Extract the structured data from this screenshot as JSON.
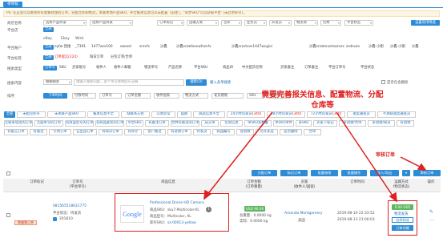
{
  "tab_label": "待审核",
  "notice": "PS: 在这里可以看到所有需要处理的订单，分配仓库和物流，关联本地产品SKU，补全报关信息可以去配置（前往），\"同步SKU\"可以获取平台（未启用库存）。",
  "filters": {
    "shop_name_label": "商店名称",
    "platform_label": "平台店",
    "platform_account_label": "平台账户",
    "platform_tags_label": "平台标签",
    "search_type_label": "搜索类型",
    "search_content_label": "搜索内容",
    "sort_label": "排序",
    "row1": [
      "选择产品目录",
      "选择产品目录",
      "订单标记",
      "运输方式",
      "仓库",
      "业务员",
      "开发员",
      "物流商",
      "包材",
      "平台状态"
    ],
    "advanced_search": "设置常用筛选",
    "platforms": [
      "eBay",
      "Ebay",
      "Wish"
    ],
    "platform_selected": "全部",
    "accounts": [
      "全部",
      "eyfw-团维",
      "_T391",
      "1477azv100",
      "ewasd",
      "srzvfx",
      "沙鑫",
      "沙鑫srzwfxzvwfxzvfx",
      "沙鑫srzvtxvs1447wcgioi",
      "沙鑫srzwtxvetxzzvzx",
      "zsdsvza",
      "沙鑫-小刚",
      "沙鑫-小刚",
      "沙鑫"
    ],
    "tags": [
      "已标记",
      "订单留言(224)",
      "缺货订单",
      "分包订单/合单"
    ],
    "search_types": [
      "订单号",
      "SKU",
      "买家账号",
      "收件人",
      "收件人邮箱",
      "物流单号",
      "产品名称",
      "平台SKU",
      "商品ID",
      "中文配货名称",
      "买家备注",
      "订单备注",
      "平台订单号",
      "平台状态"
    ],
    "search_mode": "模糊搜索",
    "search_placeholder": "请输入搜索内容，多个单号请用回车分隔",
    "search_button": "搜索(D)",
    "import_search": "输入多单搜索",
    "include_deleted": "是否包含删除",
    "sorts": [
      "下单时间",
      "付款时间",
      "订单号",
      "订单金额",
      "收件国家",
      "物流方式",
      "发货期限",
      "SKU",
      "发货单"
    ]
  },
  "filter_buttons": {
    "all": "全部",
    "row1": [
      {
        "label": "未配完库存",
        "count": ""
      },
      {
        "label": "未关联产品SKU",
        "count": ""
      },
      {
        "label": "报关信息不全",
        "count": ""
      },
      {
        "label": "缺联系方式",
        "count": ""
      },
      {
        "label": "交易异常",
        "count": ""
      },
      {
        "label": "超期",
        "count": ""
      },
      {
        "label": "商品信息不全",
        "count": ""
      },
      {
        "label": "24小时内发货",
        "count": "(340)"
      },
      {
        "label": "48小时内发货",
        "count": "(340)"
      },
      {
        "label": "72小时内发货",
        "count": "(340)"
      },
      {
        "label": "速卖通发货",
        "count": ""
      },
      {
        "label": "不关联速卖通发货",
        "count": ""
      }
    ],
    "row2": [
      "无联系电话的订单",
      "无面单号的订单",
      "有商品型号的订单",
      "有商品套装的订单",
      "平台SKU",
      "有备注订单",
      "合并有备注的订单",
      "成交单",
      "包装信息",
      "单SKU多数量",
      "单SKU单件",
      "多SKU",
      "买家下标记",
      "多退款/合单",
      "多退款/缺货",
      "有退款"
    ],
    "row3": [
      "有留言订单",
      "有备注",
      "引用订单",
      "已出运订单",
      "有缺货订单",
      "有库存",
      "客户备注",
      "有退款订单",
      "待发货",
      "商品编号",
      "含退款",
      "允许多选",
      "是否删除",
      "合单"
    ]
  },
  "toolbar": {
    "batch_label": "批量(AI)",
    "buttons": [
      "分配订单",
      "标记订单",
      "批量修改",
      "批量操作",
      "导入/导出",
      "打印面单",
      "审核订单"
    ]
  },
  "table": {
    "headers": [
      "订单标记",
      "订单号\n(平台单号)",
      "商品信息",
      "订单金额\n(订单重量)",
      "买家\n(收件人/国家)",
      "订单时间",
      "运输方式\n(物流状态)",
      "操作"
    ],
    "row": {
      "tag": "需编辑订单",
      "order_no": "081565518631775",
      "platform_status_label": "平台状态：",
      "platform_status": "待发货",
      "shop": "201810",
      "product_name": "Professional Drone HD Camera",
      "product_sku_label": "商品SKU：",
      "product_sku": "sku7-Multicolor-XL",
      "product_qty": "1",
      "product_model_label": "商品型号：",
      "product_model": "Multicolor, XL",
      "warehouse_sku_label": "库存SKU：",
      "warehouse_sku": "sz-00013-yellow",
      "amount": "USD 90.00",
      "weight_label_1": "总重量：",
      "weight_1": "0.0000 kg",
      "weight_label_2": "实际：",
      "weight_2": "0.0000 kg",
      "buyer": "Amanda Montgomery",
      "country": "美国",
      "order_time_1": "2019-08-10 22:33:52",
      "order_time_2": "2019-08-13 21:00:03",
      "ship_amount": "0.00 USD",
      "ship_label": "物流发货",
      "ship_btn": "选择物流",
      "print_btn": "订单详情"
    }
  },
  "annotations": {
    "main": "需要完善报关信息、配置物流、分配仓库等",
    "review": "审核订单",
    "google_logo": "Google",
    "accent": "#e02020",
    "brand": "#2e8bd6"
  }
}
